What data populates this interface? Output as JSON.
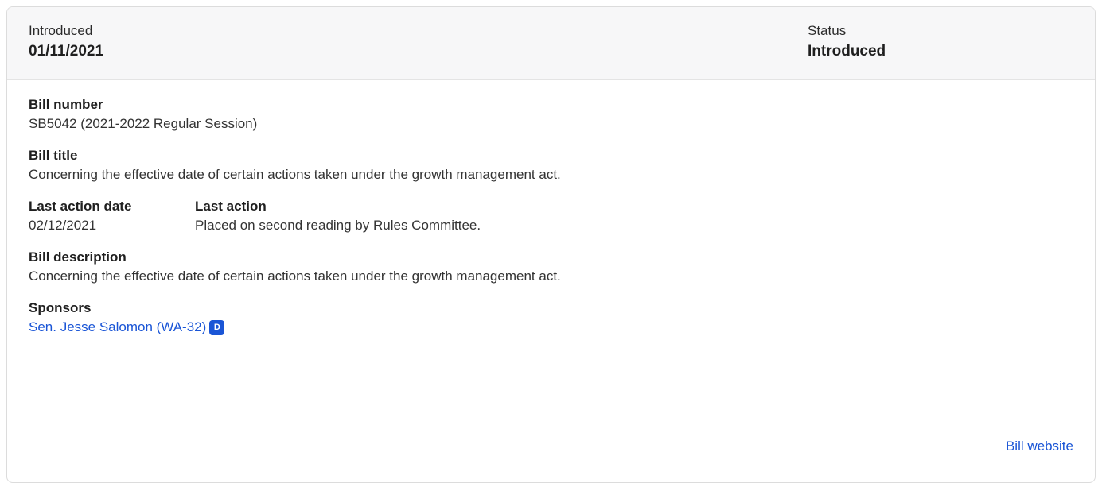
{
  "header": {
    "introduced_label": "Introduced",
    "introduced_value": "01/11/2021",
    "status_label": "Status",
    "status_value": "Introduced"
  },
  "bill": {
    "number_label": "Bill number",
    "number_value": "SB5042 (2021-2022 Regular Session)",
    "title_label": "Bill title",
    "title_value": "Concerning the effective date of certain actions taken under the growth management act.",
    "last_action_date_label": "Last action date",
    "last_action_date_value": "02/12/2021",
    "last_action_label": "Last action",
    "last_action_value": "Placed on second reading by Rules Committee.",
    "description_label": "Bill description",
    "description_value": "Concerning the effective date of certain actions taken under the growth management act."
  },
  "sponsors": {
    "label": "Sponsors",
    "items": [
      {
        "name": "Sen. Jesse Salomon (WA-32)",
        "party": "D"
      }
    ]
  },
  "footer": {
    "website_label": "Bill website"
  },
  "colors": {
    "link": "#1a55d6",
    "party_democrat": "#1a55d6",
    "header_bg": "#f7f7f8"
  }
}
